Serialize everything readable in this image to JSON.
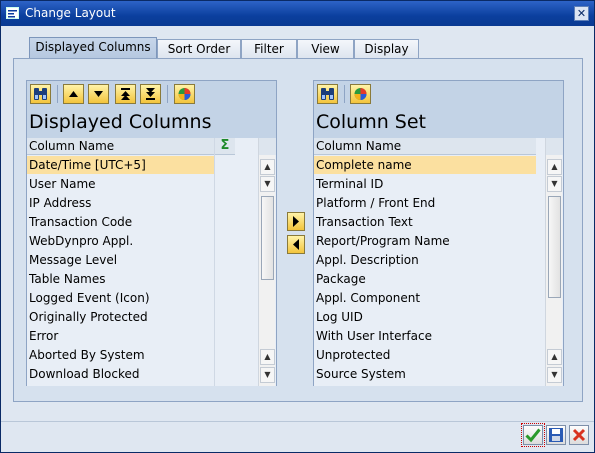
{
  "window": {
    "title": "Change Layout"
  },
  "tabs": [
    "Displayed Columns",
    "Sort Order",
    "Filter",
    "View",
    "Display"
  ],
  "left_panel": {
    "title": "Displayed Columns",
    "column_header": "Column Name",
    "rows": [
      "Date/Time [UTC+5]",
      "User Name",
      "IP Address",
      "Transaction Code",
      "WebDynpro Appl.",
      "Message Level",
      "Table Names",
      "Logged Event (Icon)",
      "Originally Protected",
      "Error",
      "Aborted By System",
      "Download Blocked"
    ],
    "selected_index": 0,
    "sum_symbol": "Σ"
  },
  "right_panel": {
    "title": "Column Set",
    "column_header": "Column Name",
    "rows": [
      "Complete name",
      "Terminal ID",
      "Platform / Front End",
      "Transaction Text",
      "Report/Program Name",
      "Appl. Description",
      "Package",
      "Appl. Component",
      "Log UID",
      "With User Interface",
      "Unprotected",
      "Source System"
    ],
    "selected_index": 0
  },
  "icons": {
    "title": "layout-icon",
    "close": "close-icon",
    "find": "binoculars-icon",
    "up": "arrow-up-icon",
    "down": "arrow-down-icon",
    "top": "arrow-top-icon",
    "bottom": "arrow-bottom-icon",
    "color": "color-wheel-icon",
    "ok": "checkmark-icon",
    "save": "save-icon",
    "cancel": "cancel-icon"
  },
  "colors": {
    "title_bar": "#0b3f9e",
    "selection": "#fbe0a0",
    "button_yellow": "#f3c43c"
  }
}
